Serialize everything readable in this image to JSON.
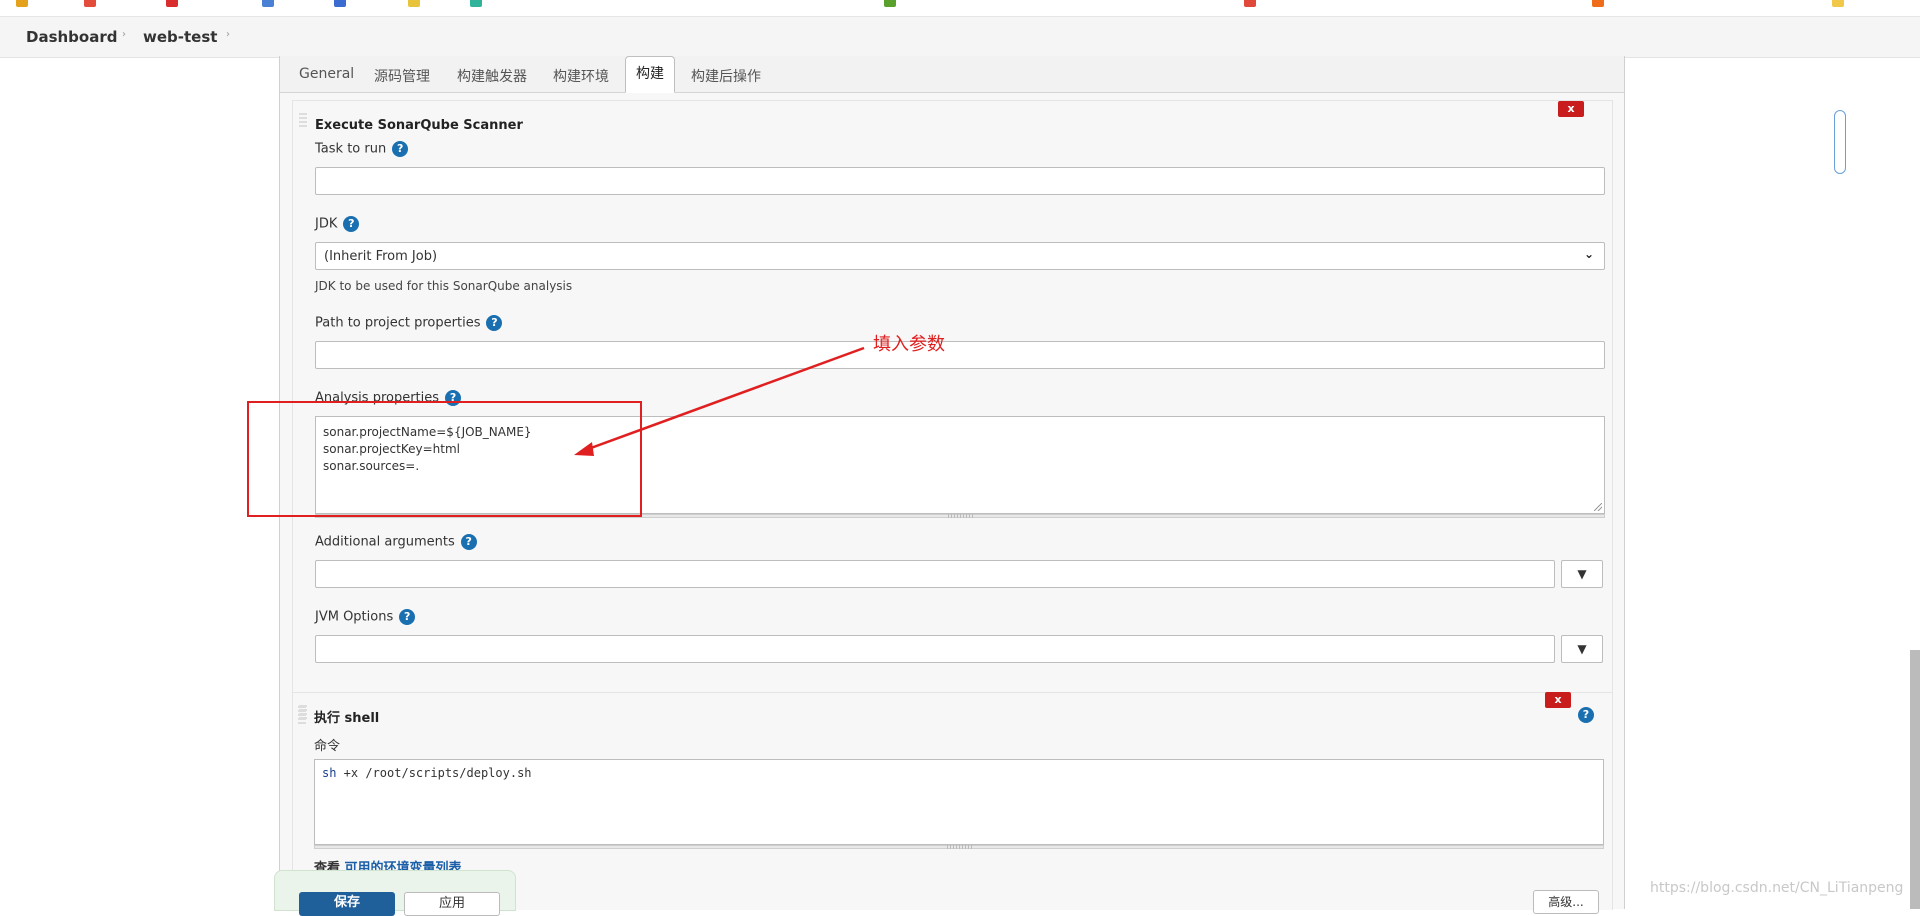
{
  "breadcrumb": {
    "items": [
      "Dashboard",
      "web-test"
    ],
    "separator": "›"
  },
  "tabs": [
    "General",
    "源码管理",
    "构建触发器",
    "构建环境",
    "构建",
    "构建后操作"
  ],
  "active_tab": "构建",
  "sonar": {
    "title": "Execute SonarQube Scanner",
    "delete_label": "x",
    "task_label": "Task to run",
    "task_value": "",
    "jdk_label": "JDK",
    "jdk_selected": "(Inherit From Job)",
    "jdk_hint": "JDK to be used for this SonarQube analysis",
    "path_label": "Path to project properties",
    "path_value": "",
    "analysis_label": "Analysis properties",
    "analysis_lines": [
      "sonar.projectName=${JOB_NAME}",
      "sonar.projectKey=html",
      "sonar.sources=."
    ],
    "args_label": "Additional arguments",
    "args_value": "",
    "args_dropdown": "▼",
    "jvm_label": "JVM Options",
    "jvm_value": "",
    "jvm_dropdown": "▼"
  },
  "shell": {
    "title": "执行 shell",
    "delete_label": "x",
    "command_label": "命令",
    "command_keyword": "sh",
    "command_rest": " +x /root/scripts/deploy.sh",
    "env_prefix": "查看 ",
    "env_link": "可用的环境变量列表"
  },
  "help_glyph": "?",
  "annotation": {
    "text": "填入参数",
    "color": "#e02020"
  },
  "buttons": {
    "save": "保存",
    "apply": "应用",
    "advanced": "高级..."
  },
  "watermark": "https://blog.csdn.net/CN_LiTianpeng",
  "colors": {
    "accent": "#1f5f9a",
    "danger": "#c91d1d",
    "help": "#1a6fb0"
  }
}
